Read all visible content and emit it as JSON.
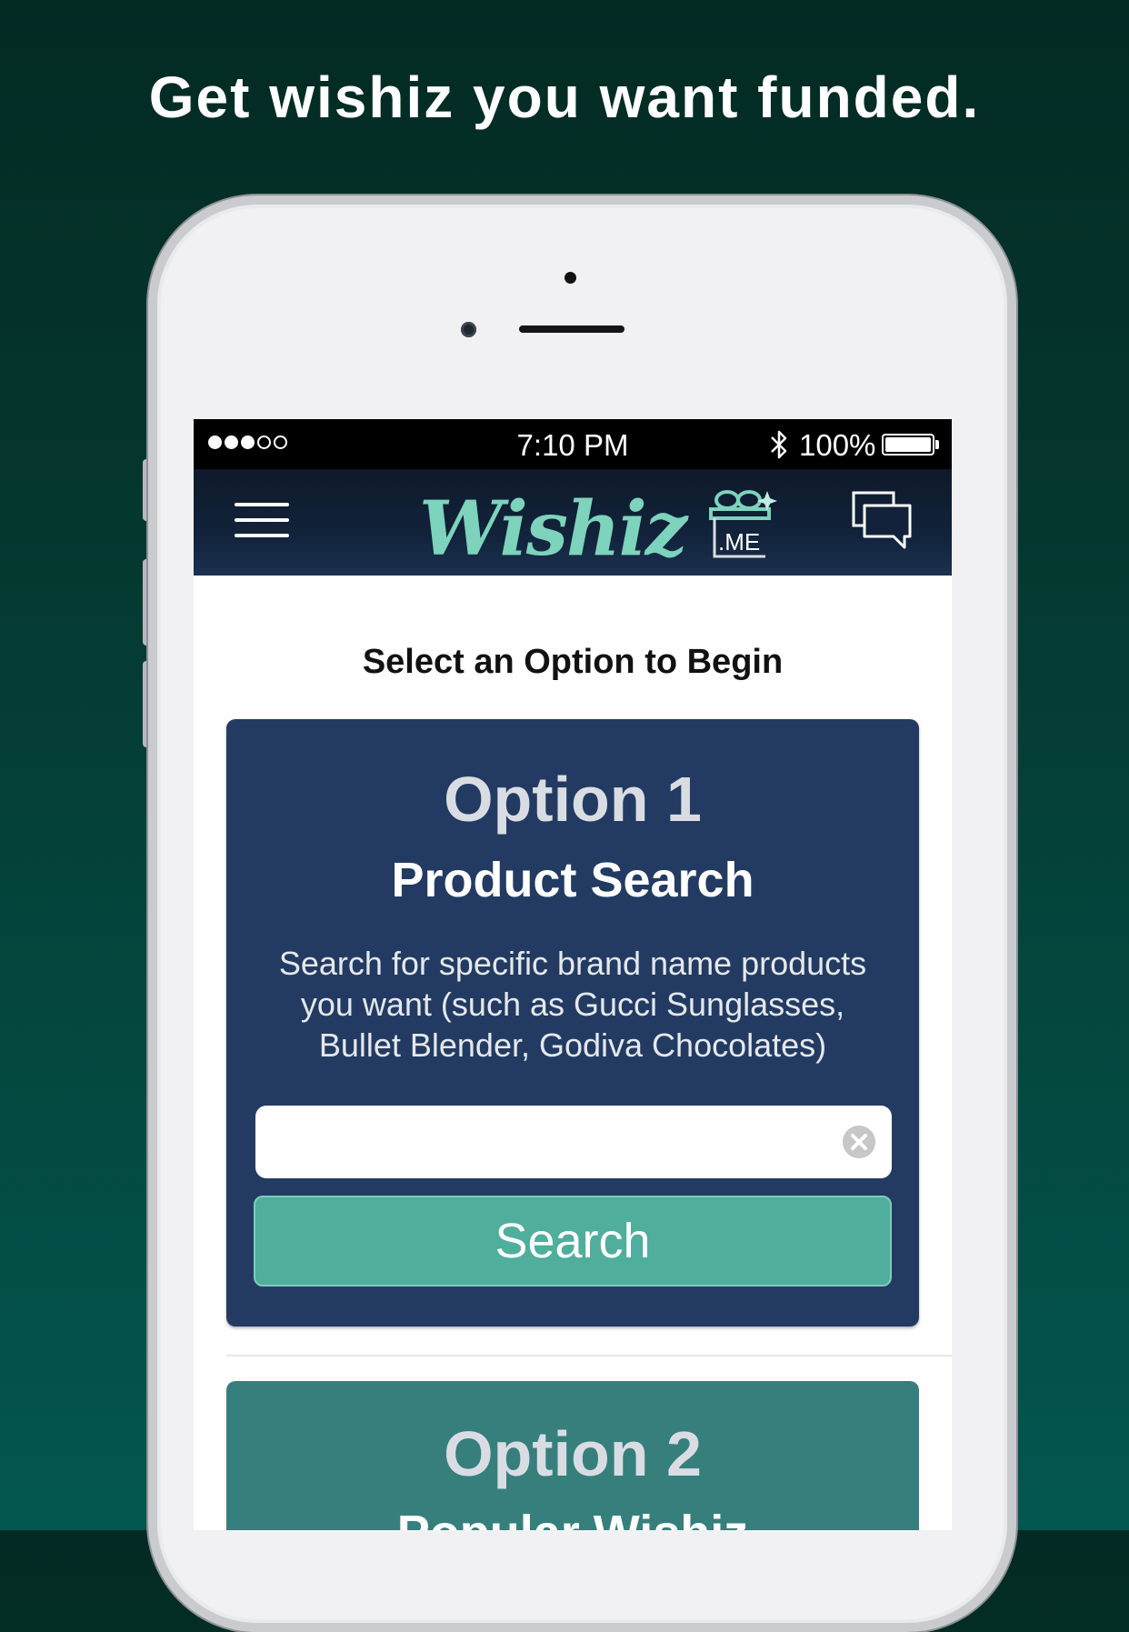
{
  "headline": "Get wishiz you want funded.",
  "status_bar": {
    "time": "7:10 PM",
    "battery": "100%",
    "signal_bars_filled": 3,
    "signal_bars_total": 5
  },
  "app_bar": {
    "logo_text": "Wishiz",
    "logo_suffix": ".ME"
  },
  "content": {
    "prompt": "Select an Option to Begin",
    "option1": {
      "title": "Option 1",
      "subtitle": "Product Search",
      "desc_line1": "Search for specific brand name products",
      "desc_line2": "you want (such as Gucci Sunglasses,",
      "desc_line3": "Bullet Blender, Godiva Chocolates)",
      "search_value": "",
      "search_button": "Search"
    },
    "option2": {
      "title": "Option 2",
      "subtitle": "Popular Wishiz"
    }
  },
  "colors": {
    "background": "#03493f",
    "appbar": "#11223a",
    "card1": "#233b62",
    "card2": "#367f7c",
    "search_button": "#4fae9c",
    "logo": "#7dd3bb"
  }
}
